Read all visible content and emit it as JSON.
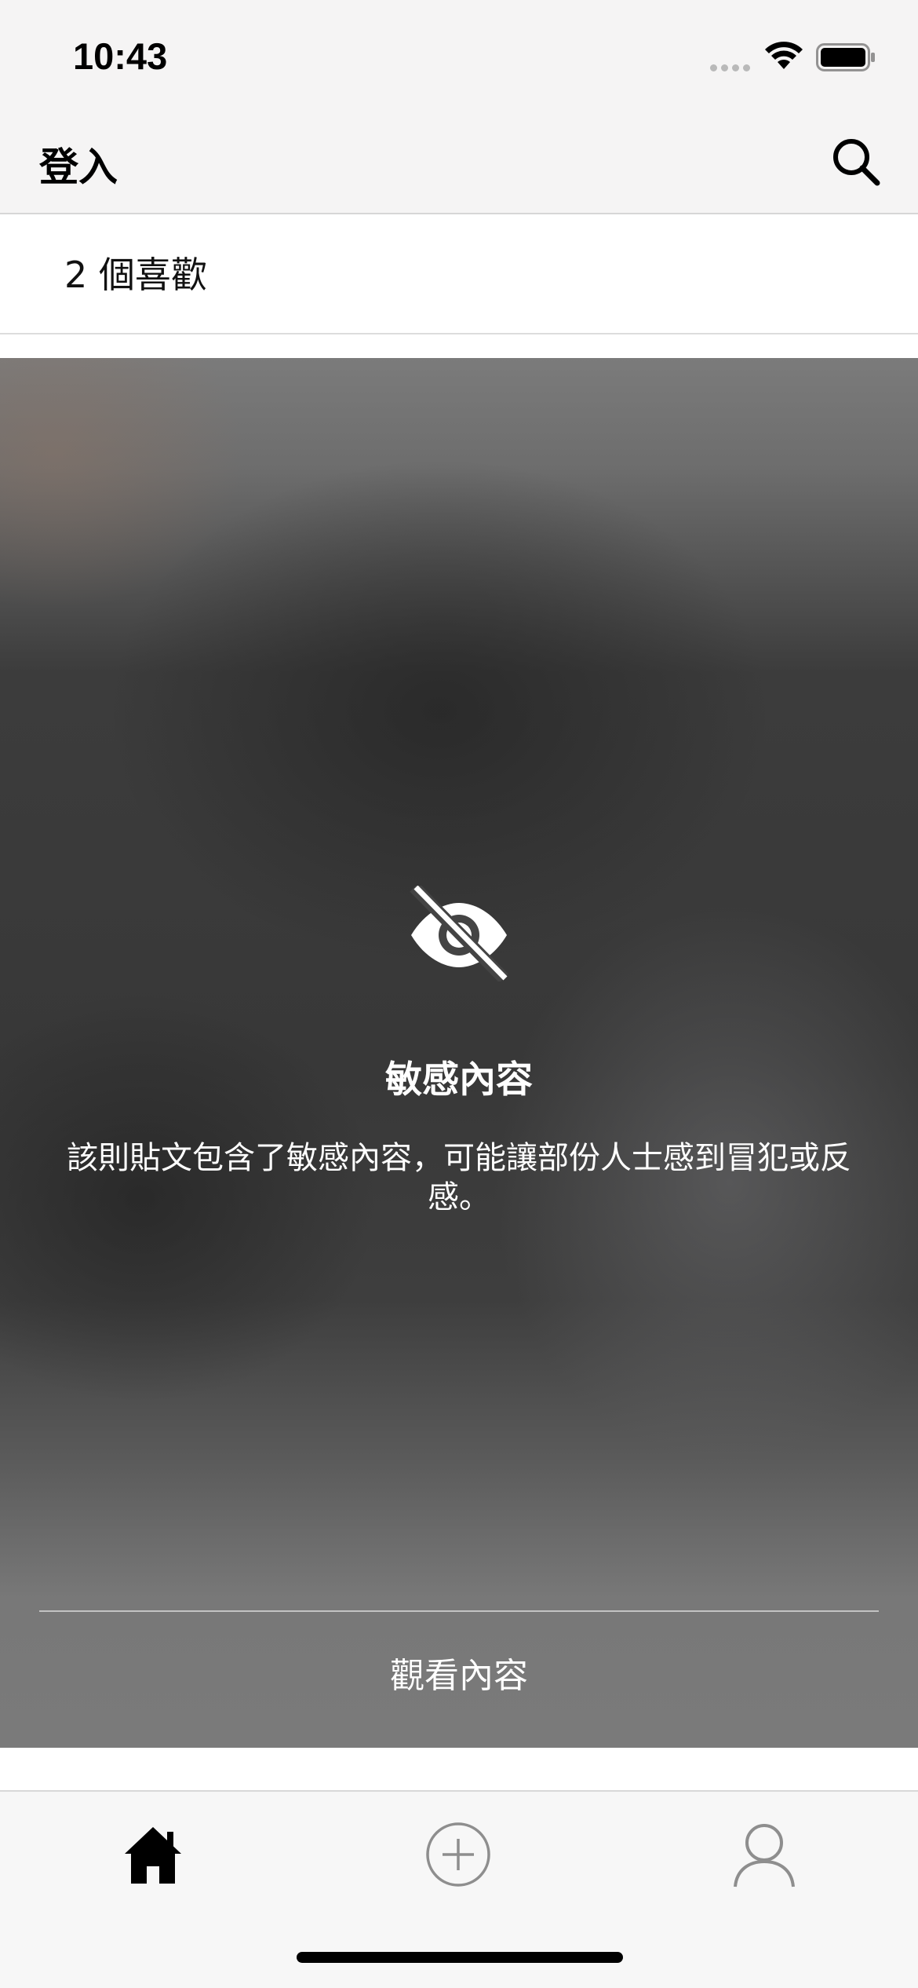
{
  "status_bar": {
    "time": "10:43",
    "icons": [
      "signal-dots-icon",
      "wifi-icon",
      "battery-icon"
    ]
  },
  "nav": {
    "title": "登入",
    "search_icon": "search-icon"
  },
  "post": {
    "likes_text": "2 個喜歡"
  },
  "sensitive": {
    "icon": "eye-slash-icon",
    "title": "敏感內容",
    "description": "該則貼文包含了敏感內容，可能讓部份人士感到冒犯或反感。",
    "view_label": "觀看內容"
  },
  "tab_bar": {
    "items": [
      {
        "icon": "home-icon",
        "active": true
      },
      {
        "icon": "add-circle-icon",
        "active": false
      },
      {
        "icon": "person-icon",
        "active": false
      }
    ]
  },
  "colors": {
    "bar_background": "#f5f4f4",
    "active_tab": "#000000",
    "inactive_tab": "#8e8e8e",
    "overlay_text": "#ffffff"
  }
}
